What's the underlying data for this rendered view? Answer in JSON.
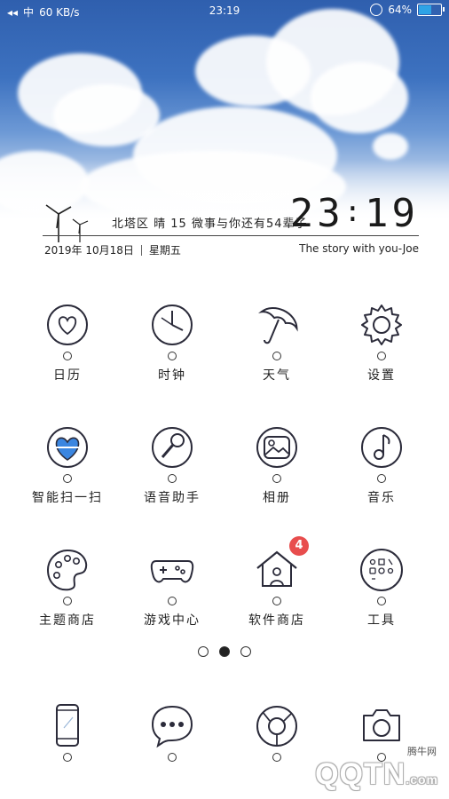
{
  "status_bar": {
    "left_icons": "◂◂",
    "signal_glyph": "中",
    "net_speed": "60 KB/s",
    "time": "23:19",
    "battery_percent": "64%",
    "battery_level": 0.64
  },
  "widget": {
    "weather_line": "北塔区 晴 15 微事与你还有54辈子",
    "big_time_h": "23",
    "big_time_sep": ":",
    "big_time_m": "19",
    "date": "2019年  10月18日",
    "weekday": "星期五",
    "quote": "The story with you-Joe"
  },
  "apps": {
    "row1": [
      {
        "label": "日历",
        "icon": "heart-calendar-icon"
      },
      {
        "label": "时钟",
        "icon": "clock-icon"
      },
      {
        "label": "天气",
        "icon": "umbrella-icon"
      },
      {
        "label": "设置",
        "icon": "gear-icon"
      }
    ],
    "row2": [
      {
        "label": "智能扫一扫",
        "icon": "heart-scan-icon"
      },
      {
        "label": "语音助手",
        "icon": "microphone-icon"
      },
      {
        "label": "相册",
        "icon": "photo-icon"
      },
      {
        "label": "音乐",
        "icon": "music-note-icon"
      }
    ],
    "row3": [
      {
        "label": "主题商店",
        "icon": "palette-icon"
      },
      {
        "label": "游戏中心",
        "icon": "gamepad-icon"
      },
      {
        "label": "软件商店",
        "icon": "house-icon",
        "badge": "4"
      },
      {
        "label": "工具",
        "icon": "tools-folder-icon"
      }
    ]
  },
  "pager": {
    "pages": 3,
    "active": 2
  },
  "dock": [
    {
      "icon": "phone-icon"
    },
    {
      "icon": "message-icon"
    },
    {
      "icon": "browser-icon"
    },
    {
      "icon": "camera-icon"
    }
  ],
  "colors": {
    "badge": "#e84d4d",
    "heart_blue": "#3b86e0",
    "battery_fill": "#2ea3e6",
    "line": "#2b2b3a"
  },
  "watermark": {
    "cn": "腾牛网",
    "en": "QQTN",
    "suffix": ".com"
  }
}
